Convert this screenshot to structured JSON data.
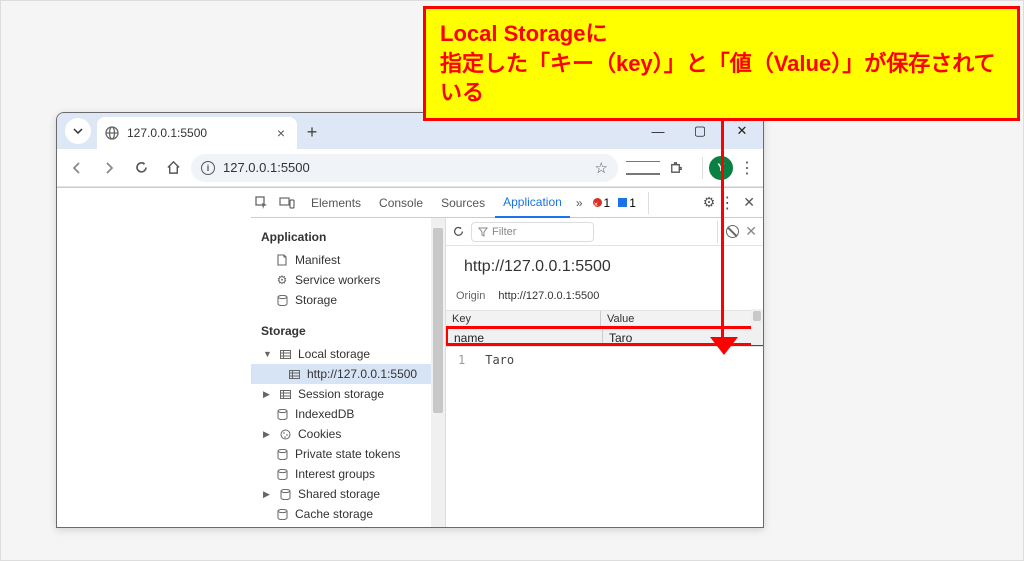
{
  "annotation": {
    "line1": "Local Storageに",
    "line2": "指定した「キー（key）」と「値（Value）」が保存されている"
  },
  "tab": {
    "title": "127.0.0.1:5500"
  },
  "address": {
    "url": "127.0.0.1:5500"
  },
  "avatar": {
    "initial": "Y"
  },
  "win": {
    "min": "—",
    "max": "▢",
    "close": "✕"
  },
  "devtools": {
    "tabs": [
      "Elements",
      "Console",
      "Sources",
      "Application"
    ],
    "activeTab": "Application",
    "errors": "1",
    "info": "1"
  },
  "sidebar": {
    "section1": "Application",
    "app_items": [
      "Manifest",
      "Service workers",
      "Storage"
    ],
    "section2": "Storage",
    "ls_label": "Local storage",
    "ls_origin": "http://127.0.0.1:5500",
    "ss_label": "Session storage",
    "idb_label": "IndexedDB",
    "cookies_label": "Cookies",
    "pst_label": "Private state tokens",
    "ig_label": "Interest groups",
    "shs_label": "Shared storage",
    "cs_label": "Cache storage"
  },
  "content": {
    "filter_placeholder": "Filter",
    "title": "http://127.0.0.1:5500",
    "origin_label": "Origin",
    "origin_value": "http://127.0.0.1:5500",
    "col_key": "Key",
    "col_value": "Value",
    "row_key": "name",
    "row_value": "Taro",
    "preview_index": "1",
    "preview_value": "Taro"
  }
}
